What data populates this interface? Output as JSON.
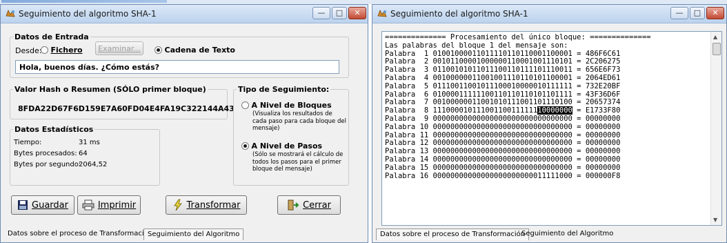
{
  "colors": {
    "accent": "#3a78c8",
    "close": "#c24a33",
    "selection": "#000000"
  },
  "window1": {
    "title": "Seguimiento del algoritmo SHA-1",
    "caption_buttons": {
      "minimize": "—",
      "maximize": "□",
      "close": "✕"
    },
    "entrada": {
      "legend": "Datos de Entrada",
      "desde_label": "Desde:",
      "fichero_label": "Fichero",
      "examinar_label": "Examinar...",
      "cadena_label": "Cadena de Texto",
      "selected": "cadena",
      "text_value": "Hola, buenos días. ¿Cómo estás?"
    },
    "hash": {
      "legend": "Valor Hash o Resumen (SÓLO primer bloque)",
      "value": "8FDA22D67F6D159E7A60FD04E4FA19C322144A43"
    },
    "estadisticos": {
      "legend": "Datos Estadísticos",
      "rows": [
        {
          "label": "Tiempo:",
          "value": "31 ms"
        },
        {
          "label": "Bytes procesados:",
          "value": "64"
        },
        {
          "label": "Bytes por segundo:",
          "value": "2064,52"
        }
      ]
    },
    "tipo": {
      "legend": "Tipo de Seguimiento:",
      "bloques_title": "A Nivel de Bloques",
      "bloques_desc": "(Visualiza los resultados de cada paso para cada bloque del mensaje)",
      "pasos_title": "A Nivel de Pasos",
      "pasos_desc": "(Sólo se mostrará el cálculo de todos los pasos para el primer bloque del mensaje)",
      "selected": "pasos"
    },
    "buttons": {
      "guardar": "Guardar",
      "imprimir": "Imprimir",
      "transformar": "Transformar",
      "cerrar": "Cerrar"
    },
    "tabs": [
      "Datos sobre el proceso de Transformación",
      "Seguimiento del Algoritmo"
    ],
    "active_tab": 0
  },
  "window2": {
    "title": "Seguimiento del algoritmo SHA-1",
    "caption_buttons": {
      "minimize": "—",
      "maximize": "□",
      "close": "✕"
    },
    "header_line": "============== Procesamiento del único bloque: ==============",
    "sub_line": "Las palabras del bloque 1 del mensaje son:",
    "words": [
      {
        "label": "Palabra  1",
        "bits": "01001000011011110110110001100001",
        "hex": "486F6C61"
      },
      {
        "label": "Palabra  2",
        "bits": "00101100001000000110001001110101",
        "hex": "2C206275"
      },
      {
        "label": "Palabra  3",
        "bits": "01100101011011100110111101110011",
        "hex": "656E6F73"
      },
      {
        "label": "Palabra  4",
        "bits": "00100000011001001110110101100001",
        "hex": "2064ED61"
      },
      {
        "label": "Palabra  5",
        "bits": "01110011001011100010000010111111",
        "hex": "732E20BF"
      },
      {
        "label": "Palabra  6",
        "bits": "01000011111100110110110101101111",
        "hex": "43F36D6F"
      },
      {
        "label": "Palabra  7",
        "bits": "00100000011001010111001101110100",
        "hex": "20657374"
      },
      {
        "label": "Palabra  8",
        "bits_plain": "111000010111001100111111",
        "bits_selected": "10000000",
        "hex": "E1733F80"
      },
      {
        "label": "Palabra  9",
        "bits": "00000000000000000000000000000000",
        "hex": "00000000"
      },
      {
        "label": "Palabra 10",
        "bits": "00000000000000000000000000000000",
        "hex": "00000000"
      },
      {
        "label": "Palabra 11",
        "bits": "00000000000000000000000000000000",
        "hex": "00000000"
      },
      {
        "label": "Palabra 12",
        "bits": "00000000000000000000000000000000",
        "hex": "00000000"
      },
      {
        "label": "Palabra 13",
        "bits": "00000000000000000000000000000000",
        "hex": "00000000"
      },
      {
        "label": "Palabra 14",
        "bits": "00000000000000000000000000000000",
        "hex": "00000000"
      },
      {
        "label": "Palabra 15",
        "bits": "00000000000000000000000000000000",
        "hex": "00000000"
      },
      {
        "label": "Palabra 16",
        "bits": "00000000000000000000000011111000",
        "hex": "000000F8"
      }
    ],
    "tabs": [
      "Datos sobre el proceso de Transformación",
      "Seguimiento del Algoritmo"
    ],
    "active_tab": 1
  }
}
